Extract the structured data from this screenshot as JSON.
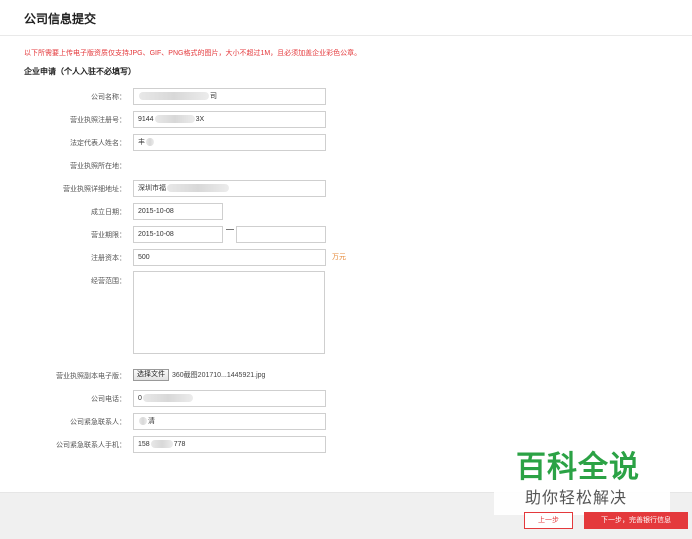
{
  "header": {
    "title": "公司信息提交"
  },
  "notice": "以下所需要上传电子版资质仅支持JPG、GIF、PNG格式的图片，大小不超过1M，且必须加盖企业彩色公章。",
  "section_title": "企业申请（个人入驻不必填写）",
  "fields": {
    "company_name": {
      "label": "公司名称：",
      "prefix": "",
      "suffix": "司"
    },
    "license_no": {
      "label": "营业执照注册号：",
      "prefix": "9144",
      "suffix": "3X"
    },
    "legal_rep": {
      "label": "法定代表人姓名：",
      "prefix": "丰"
    },
    "license_location": {
      "label": "营业执照所在地："
    },
    "license_address": {
      "label": "营业执照详细地址：",
      "prefix": "深圳市福"
    },
    "founded_date": {
      "label": "成立日期：",
      "value": "2015-10-08"
    },
    "business_term": {
      "label": "营业期限：",
      "start": "2015-10-08",
      "separator": "—",
      "end": ""
    },
    "registered_capital": {
      "label": "注册资本：",
      "value": "500",
      "unit": "万元"
    },
    "business_scope": {
      "label": "经营范围：",
      "value": ""
    },
    "license_copy": {
      "label": "营业执照副本电子版：",
      "button": "选择文件",
      "file_name": "360截图201710...1445921.jpg"
    },
    "company_phone": {
      "label": "公司电话：",
      "prefix": "0"
    },
    "emergency_contact": {
      "label": "公司紧急联系人：",
      "suffix": "清"
    },
    "emergency_mobile": {
      "label": "公司紧急联系人手机：",
      "prefix": "158",
      "suffix": "778"
    }
  },
  "buttons": {
    "prev": "上一步",
    "next": "下一步，完善银行信息"
  },
  "watermark": {
    "main": "百科全说",
    "sub": "助你轻松解决"
  },
  "colors": {
    "accent": "#e4393c",
    "unit": "#e68a3a",
    "watermark": "#2ba245"
  }
}
